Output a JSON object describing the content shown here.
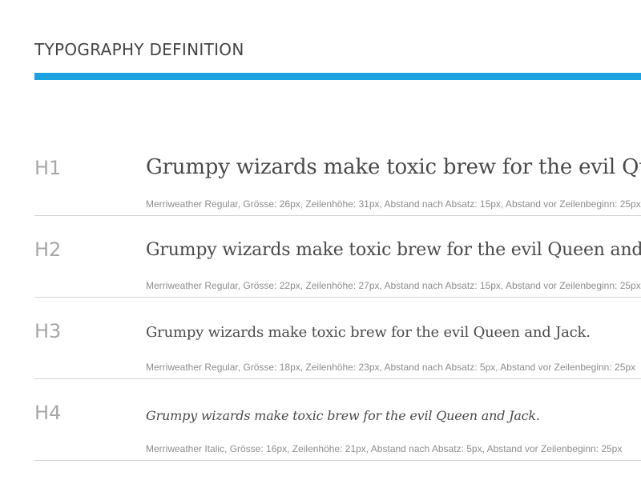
{
  "header": {
    "title": "TYPOGRAPHY DEFINITION",
    "accent_color": "#1aa3e0"
  },
  "styles": [
    {
      "tag": "H1",
      "sample": "Grumpy wizards make toxic brew for the evil Queen and Jack.",
      "spec": "Merriweather Regular, Grösse: 26px, Zeilenhöhe: 31px, Abstand nach Absatz: 15px, Abstand vor Zeilenbeginn: 25px"
    },
    {
      "tag": "H2",
      "sample": "Grumpy wizards make toxic brew for the evil Queen and Jack.",
      "spec": "Merriweather Regular, Grösse: 22px, Zeilenhöhe: 27px, Abstand nach Absatz: 15px, Abstand vor Zeilenbeginn: 25px"
    },
    {
      "tag": "H3",
      "sample": "Grumpy wizards make toxic brew for the evil Queen and Jack.",
      "spec": "Merriweather Regular, Grösse: 18px, Zeilenhöhe: 23px, Abstand nach Absatz: 5px, Abstand vor Zeilenbeginn: 25px"
    },
    {
      "tag": "H4",
      "sample": "Grumpy wizards make toxic brew for the evil Queen and Jack.",
      "spec": "Merriweather Italic, Grösse: 16px, Zeilenhöhe: 21px, Abstand nach Absatz: 5px, Abstand vor Zeilenbeginn: 25px"
    }
  ]
}
